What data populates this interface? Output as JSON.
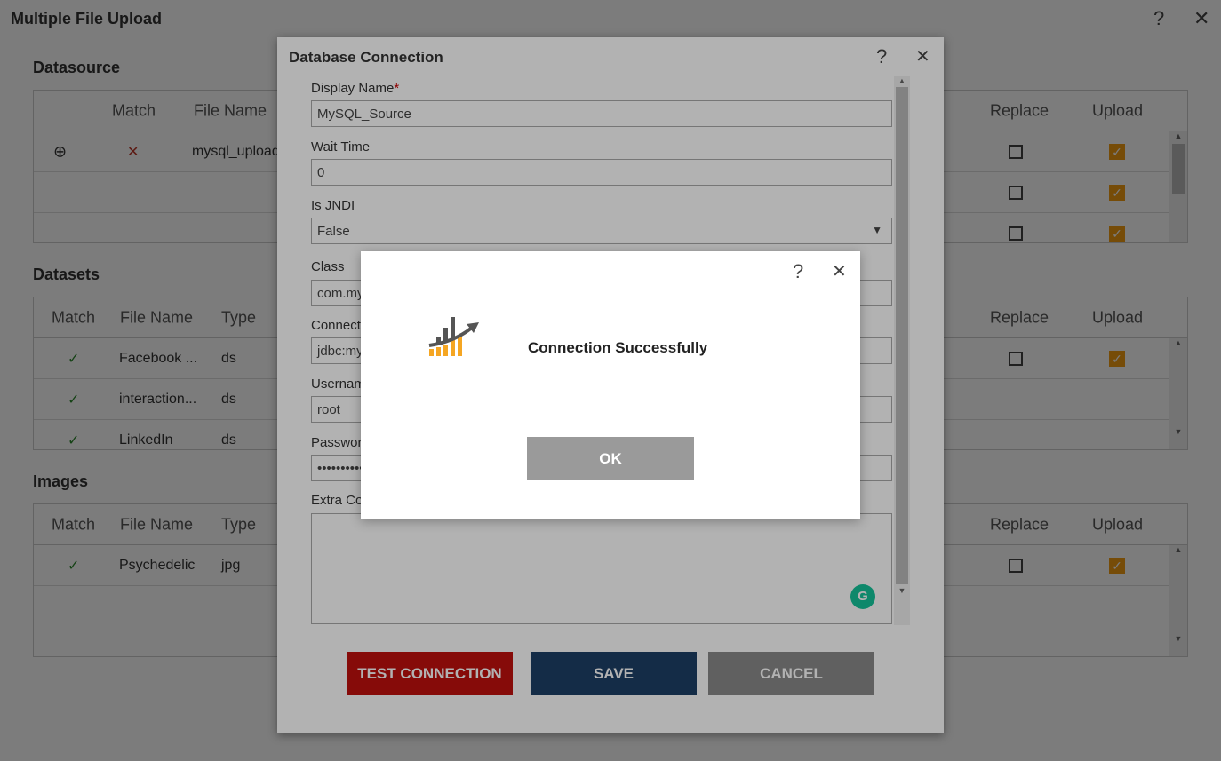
{
  "page": {
    "title": "Multiple File Upload",
    "help": "?",
    "close": "✕"
  },
  "datasource": {
    "title": "Datasource",
    "headers": {
      "match": "Match",
      "file_name": "File Name",
      "replace": "Replace",
      "upload": "Upload"
    },
    "rows": [
      {
        "match": "✕",
        "file_name": "mysql_upload",
        "replace": false,
        "upload": true
      },
      {
        "replace": false,
        "upload": true
      },
      {
        "replace": false,
        "upload": true
      }
    ]
  },
  "datasets": {
    "title": "Datasets",
    "headers": {
      "match": "Match",
      "file_name": "File Name",
      "type": "Type",
      "replace": "Replace",
      "upload": "Upload"
    },
    "rows": [
      {
        "match": "✓",
        "file_name": "Facebook ...",
        "type": "ds"
      },
      {
        "match": "✓",
        "file_name": "interaction...",
        "type": "ds"
      },
      {
        "match": "✓",
        "file_name": "LinkedIn",
        "type": "ds"
      }
    ]
  },
  "images": {
    "title": "Images",
    "headers": {
      "match": "Match",
      "file_name": "File Name",
      "type": "Type",
      "replace": "Replace",
      "upload": "Upload"
    },
    "rows": [
      {
        "match": "✓",
        "file_name": "Psychedelic",
        "type": "jpg"
      }
    ]
  },
  "dialog": {
    "title": "Database Connection",
    "help": "?",
    "close": "✕",
    "fields": {
      "display_name_label": "Display Name",
      "required": "*",
      "display_name": "MySQL_Source",
      "wait_time_label": "Wait Time",
      "wait_time": "0",
      "jndi_label": "Is JNDI",
      "jndi": "False",
      "class_label": "Class",
      "class": "com.my",
      "connection_label": "Connect",
      "connection": "jdbc:my",
      "username_label": "Usernam",
      "username": "root",
      "password_label": "Passwor",
      "password": "••••••••••",
      "extra_label": "Extra Co"
    },
    "buttons": {
      "test": "TEST CONNECTION",
      "save": "SAVE",
      "cancel": "CANCEL"
    }
  },
  "popup": {
    "help": "?",
    "close": "✕",
    "message": "Connection Successfully",
    "ok": "OK"
  },
  "colors": {
    "accent": "#f39c12",
    "test": "#c0100e",
    "save": "#1d3f66",
    "cancel": "#8a8a8a",
    "ok": "#9a9a9a"
  }
}
